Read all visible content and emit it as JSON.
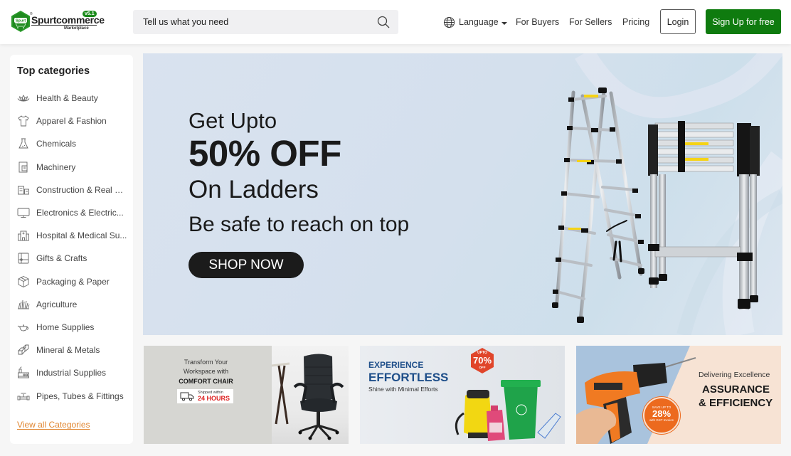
{
  "header": {
    "logo": {
      "badge_text": "Spurt",
      "brand": "Spurtcommerce",
      "version": "v5.1",
      "subtitle": "Marketplace",
      "icon": "cart-hexagon-logo"
    },
    "search": {
      "placeholder": "Tell us what you need",
      "value": "",
      "icon": "search-icon"
    },
    "language": {
      "label": "Language",
      "icon": "globe-icon"
    },
    "nav_links": [
      "For Buyers",
      "For Sellers",
      "Pricing"
    ],
    "login_label": "Login",
    "signup_label": "Sign Up for free",
    "brand_color": "#0f7b0f"
  },
  "sidebar": {
    "title": "Top categories",
    "items": [
      {
        "label": "Health &  Beauty",
        "icon": "lotus-icon"
      },
      {
        "label": "Apparel & Fashion",
        "icon": "tshirt-icon"
      },
      {
        "label": "Chemicals",
        "icon": "flask-icon"
      },
      {
        "label": "Machinery",
        "icon": "machine-icon"
      },
      {
        "label": "Construction & Real E...",
        "icon": "building-icon"
      },
      {
        "label": "Electronics & Electric...",
        "icon": "monitor-icon"
      },
      {
        "label": "Hospital & Medical Su...",
        "icon": "hospital-icon"
      },
      {
        "label": "Gifts & Crafts",
        "icon": "gift-icon"
      },
      {
        "label": "Packaging & Paper",
        "icon": "box-icon"
      },
      {
        "label": "Agriculture",
        "icon": "grass-icon"
      },
      {
        "label": "Home Supplies",
        "icon": "teapot-icon"
      },
      {
        "label": "Mineral & Metals",
        "icon": "ingots-icon"
      },
      {
        "label": "Industrial Supplies",
        "icon": "factory-icon"
      },
      {
        "label": "Pipes, Tubes & Fittings",
        "icon": "pipe-valve-icon"
      }
    ],
    "view_all": "View all Categories",
    "link_color": "#e0852f"
  },
  "hero": {
    "line1": "Get Upto",
    "line2": "50% OFF",
    "line3": "On Ladders",
    "line4": "Be safe to reach on top",
    "cta": "SHOP NOW",
    "image": "telescopic-ladders"
  },
  "promos": [
    {
      "line1": "Transform Your",
      "line2": "Workspace with",
      "line3": "COMFORT CHAIR",
      "ship_small": "Shipped within",
      "ship_big": "24 HOURS",
      "image": "office-chair"
    },
    {
      "line1": "EXPERIENCE",
      "line2": "EFFORTLESS",
      "line3": "Shine with Minimal Efforts",
      "badge_top": "UPTO",
      "badge_value": "70%",
      "badge_bottom": "OFF",
      "image": "cleaning-equipment"
    },
    {
      "line1": "Delivering Excellence",
      "line2": "ASSURANCE",
      "line3": "& EFFICIENCY",
      "badge_top": "SAVE UP TO",
      "badge_value": "28%",
      "badge_bottom": "with GST Invoice",
      "image": "cordless-drill"
    }
  ]
}
